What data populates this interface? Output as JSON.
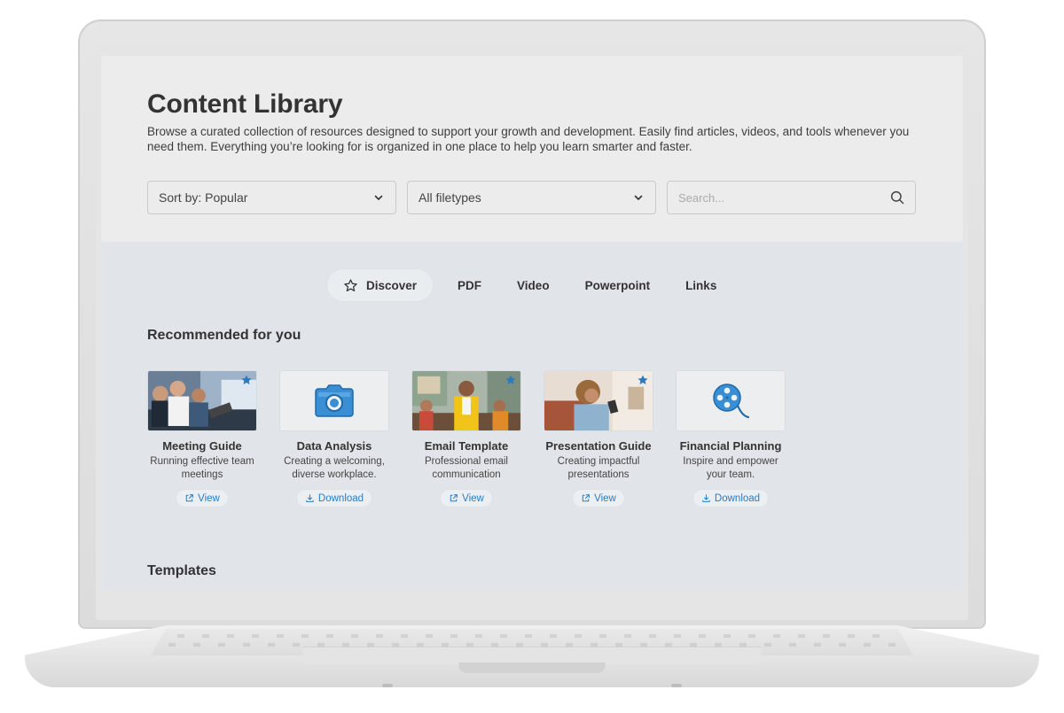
{
  "page": {
    "title": "Content Library",
    "description": "Browse a curated collection of resources designed to support your growth and development. Easily find articles, videos, and tools whenever you need them. Everything you’re looking for is organized in one place to help you learn smarter and faster."
  },
  "filters": {
    "sort": "Sort by: Popular",
    "filetype": "All filetypes",
    "search_placeholder": "Search..."
  },
  "tabs": [
    {
      "label": "Discover",
      "icon": "star-icon",
      "active": true
    },
    {
      "label": "PDF"
    },
    {
      "label": "Video"
    },
    {
      "label": "Powerpoint"
    },
    {
      "label": "Links"
    }
  ],
  "sections": {
    "recommended": "Recommended for you",
    "templates": "Templates"
  },
  "cards": [
    {
      "title": "Meeting Guide",
      "desc": "Running effective team meetings",
      "action": "View",
      "action_icon": "external-link-icon",
      "thumb": "photo-meeting",
      "favorite": true
    },
    {
      "title": "Data Analysis",
      "desc": "Creating a welcoming, diverse workplace.",
      "action": "Download",
      "action_icon": "download-icon",
      "thumb": "camera-icon",
      "favorite": false
    },
    {
      "title": "Email Template",
      "desc": "Professional email communication",
      "action": "View",
      "action_icon": "external-link-icon",
      "thumb": "photo-office",
      "favorite": true
    },
    {
      "title": "Presentation Guide",
      "desc": "Creating impactful presentations",
      "action": "View",
      "action_icon": "external-link-icon",
      "thumb": "photo-phone",
      "favorite": true
    },
    {
      "title": "Financial Planning",
      "desc": "Inspire and empower your team.",
      "action": "Download",
      "action_icon": "film-reel-icon",
      "thumb": "film-reel-icon",
      "favorite": false
    }
  ],
  "colors": {
    "accent": "#2b7bc0",
    "header_bg": "#ececec",
    "content_bg": "#e1e5ea",
    "text": "#333333"
  }
}
